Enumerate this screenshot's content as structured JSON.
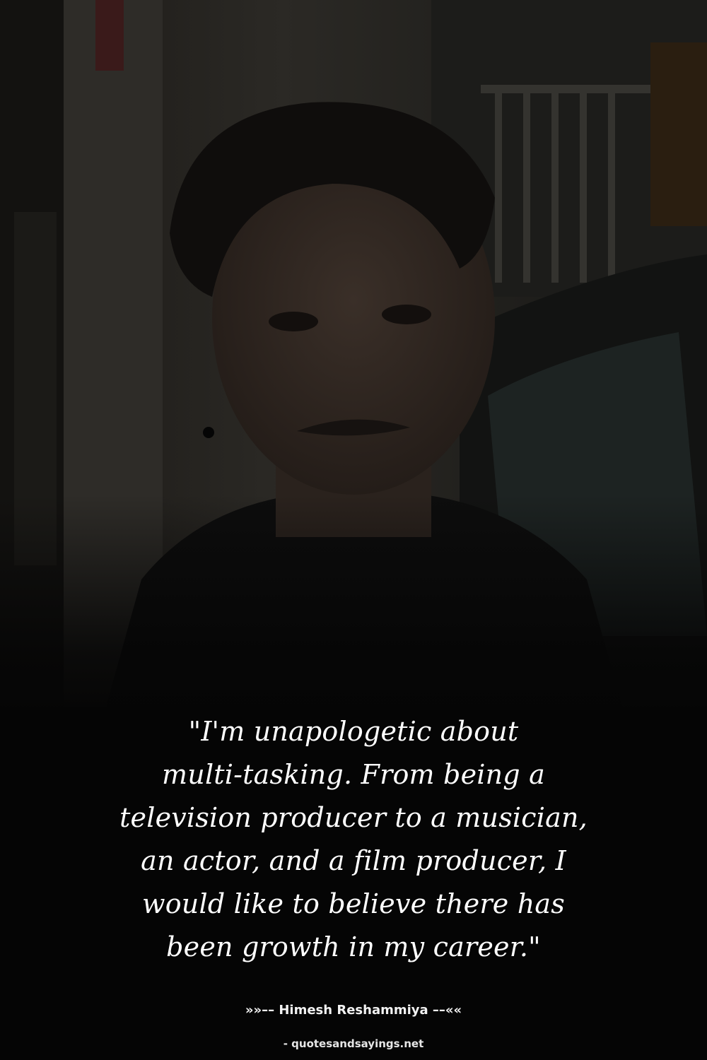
{
  "quote": {
    "text": "\"I'm unapologetic about multi-tasking. From being a television producer to a musician, an actor, and a film producer, I would like to believe there has been growth in my career.\"",
    "lines": [
      "\"I'm unapologetic about",
      "multi-tasking. From being a",
      "television producer to a musician,",
      "an actor, and a film producer, I",
      "would like to believe there has",
      "been growth in my career.\""
    ]
  },
  "author": {
    "label": "»»–– Himesh Reshammiya ––««"
  },
  "source": {
    "label": "- quotesandsayings.net"
  },
  "colors": {
    "background": "#050505",
    "text": "#ffffff"
  }
}
